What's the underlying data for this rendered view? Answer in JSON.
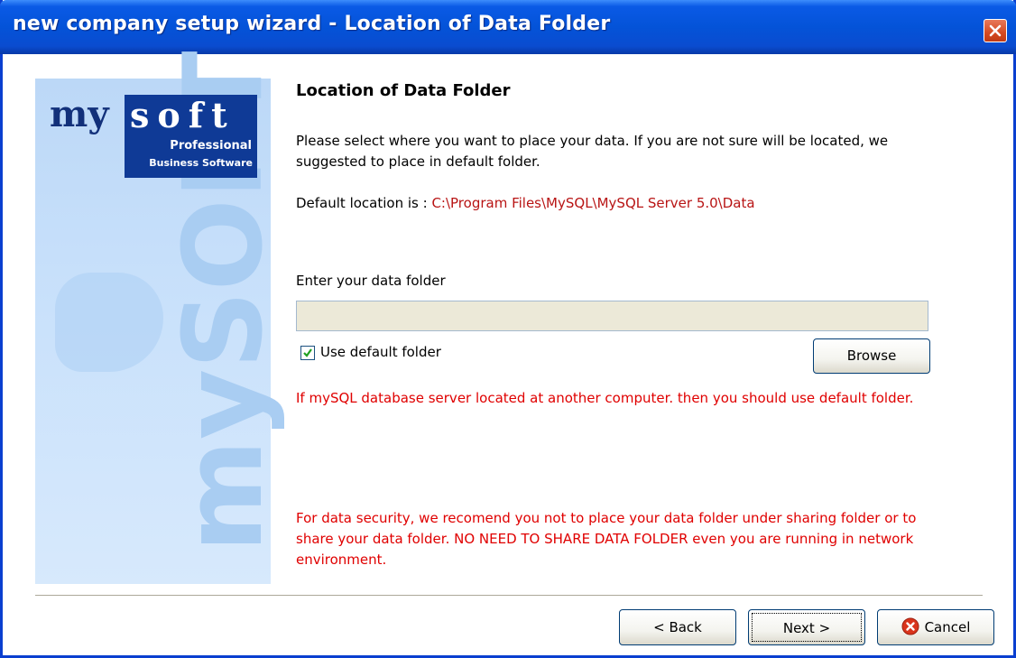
{
  "window": {
    "title": "new company setup wizard - Location of Data Folder"
  },
  "banner": {
    "logo_my": "my",
    "logo_soft": "soft",
    "logo_professional": "Professional",
    "logo_business": "Business Software",
    "watermark": "mySOFT"
  },
  "content": {
    "heading": "Location of Data Folder",
    "description": "Please select where you want to place your data. If you are not sure will be located, we suggested to place in default folder.",
    "default_location_label": "Default location is : ",
    "default_location_path": "C:\\Program Files\\MySQL\\MySQL Server 5.0\\Data",
    "enter_folder_label": "Enter your data folder",
    "folder_input_value": "",
    "use_default_label": "Use default folder",
    "use_default_checked": true,
    "browse_label": "Browse",
    "warning_network": "If mySQL database server located at another computer. then you should use default folder.",
    "warning_security": "For data security, we recomend you not to place your data folder under sharing folder or to share your data folder. NO NEED TO SHARE DATA FOLDER even you are running in network environment."
  },
  "footer": {
    "back_label": "< Back",
    "next_label": "Next >",
    "cancel_label": "Cancel"
  },
  "colors": {
    "titlebar": "#0453d8",
    "path_text": "#b81414",
    "warning_text": "#e00000",
    "banner_bg": "#c9e1fb",
    "logo_box": "#0f3a96"
  },
  "icons": {
    "close": "close-icon",
    "check": "checkmark-icon",
    "cancel": "cancel-icon"
  }
}
